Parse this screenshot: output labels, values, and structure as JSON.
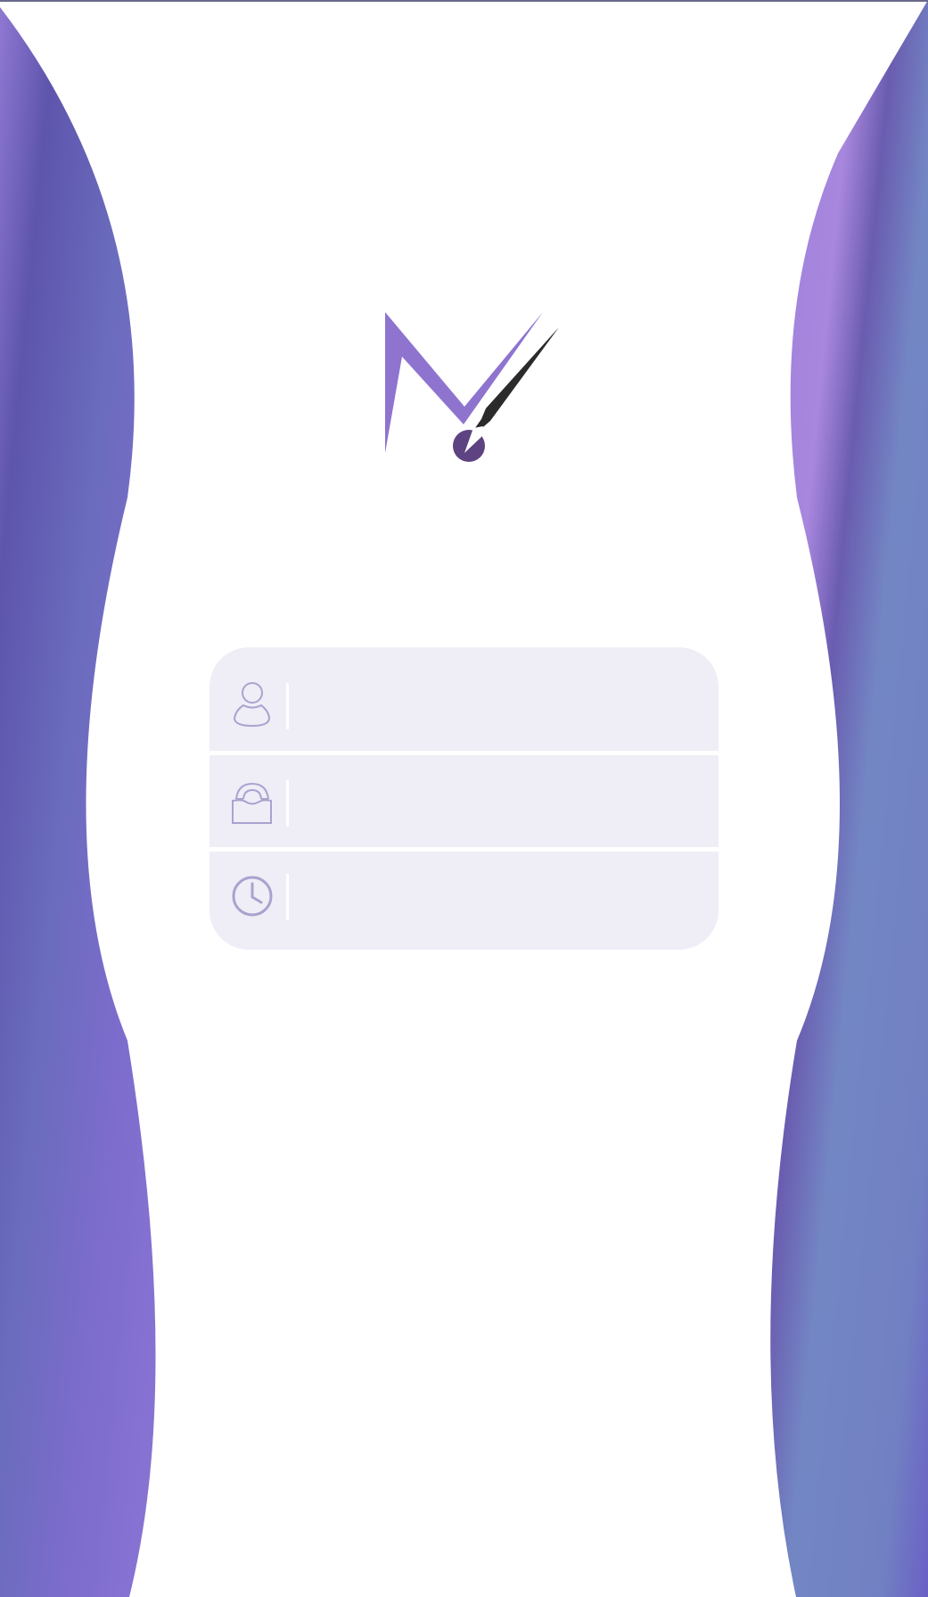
{
  "login_form": {
    "username": {
      "icon": "user-icon",
      "value": "",
      "placeholder": ""
    },
    "password": {
      "icon": "lock-icon",
      "value": "",
      "placeholder": ""
    },
    "verification_code": {
      "icon": "clock-icon",
      "value": "",
      "placeholder": ""
    }
  },
  "logo": {
    "icon": "m-checkmark-logo"
  },
  "colors": {
    "background": "#ffffff",
    "wave_purple": "#8b74d4",
    "wave_indigo": "#6658b0",
    "wave_blue": "#7386c4",
    "field_background": "#efedf6",
    "icon_stroke": "#a9a3cf",
    "logo_purple": "#8e74cf",
    "logo_dark": "#2b2b2b",
    "logo_dot": "#5e4383"
  }
}
